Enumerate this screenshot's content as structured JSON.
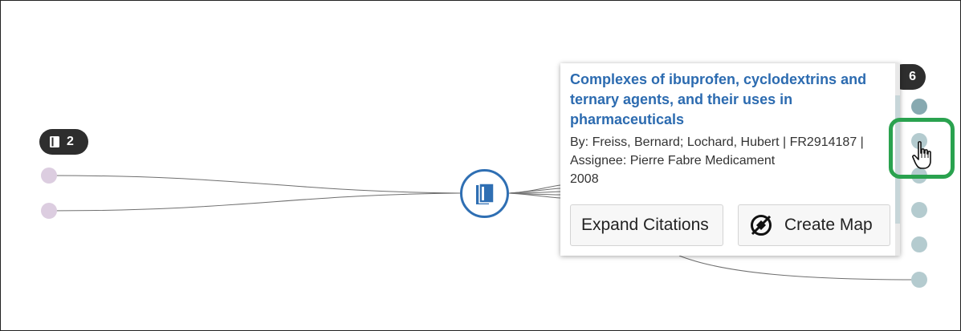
{
  "graph": {
    "left_badge": {
      "icon": "book-icon",
      "count": "2"
    },
    "right_badge": {
      "count": "6"
    },
    "center_node": {
      "icon": "book-icon",
      "color": "#2f6fb3"
    }
  },
  "popup": {
    "title": "Complexes of ibuprofen, cyclodextrins and ternary agents, and their uses in pharmaceuticals",
    "authors_line": "By: Freiss, Bernard; Lochard, Hubert | FR2914187 |",
    "assignee_line": "Assignee: Pierre Fabre Medicament",
    "year": "2008",
    "buttons": {
      "expand_label": "Expand Citations",
      "create_map_label": "Create Map",
      "create_map_icon": "compass-icon"
    }
  },
  "colors": {
    "title": "#2c6bb0",
    "highlight": "#2aa24f",
    "left_nodes": "#dccde0",
    "right_nodes": "#b4cbcf",
    "active_node": "#87a9b0"
  }
}
